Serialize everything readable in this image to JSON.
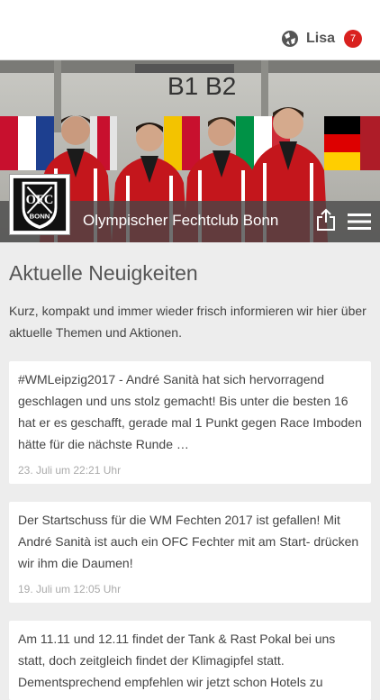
{
  "header": {
    "user_name": "Lisa",
    "notification_count": "7"
  },
  "club": {
    "name": "Olympischer Fechtclub Bonn",
    "logo_text_top": "OFC",
    "logo_text_bottom": "BONN",
    "hall_sign": "B1  B2"
  },
  "news": {
    "title": "Aktuelle Neuigkeiten",
    "intro": "Kurz, kompakt und immer wieder frisch informieren wir hier über aktuelle Themen und Aktionen.",
    "items": [
      {
        "text": "#WMLeipzig2017 - André Sanità hat sich hervorragend geschlagen und uns stolz gemacht! Bis unter die besten 16 hat er es geschafft, gerade mal 1 Punkt gegen Race Imboden hätte für die nächste Runde …",
        "date": "23. Juli um 22:21 Uhr"
      },
      {
        "text": "Der Startschuss für die WM Fechten 2017 ist gefallen! Mit André Sanità ist auch ein OFC Fechter mit am Start- drücken wir ihm die Daumen!",
        "date": "19. Juli um 12:05 Uhr"
      },
      {
        "text": "Am 11.11 und 12.11 findet der Tank & Rast Pokal bei uns statt, doch zeitgleich findet der Klimagipfel statt. Dementsprechend empfehlen wir jetzt schon Hotels zu",
        "date": ""
      }
    ]
  },
  "colors": {
    "accent": "#d9211f",
    "jacket_red": "#c4161c",
    "bar_gray": "#464646"
  },
  "icons": {
    "user": "globe-icon",
    "share": "share-icon",
    "menu": "menu-icon"
  }
}
